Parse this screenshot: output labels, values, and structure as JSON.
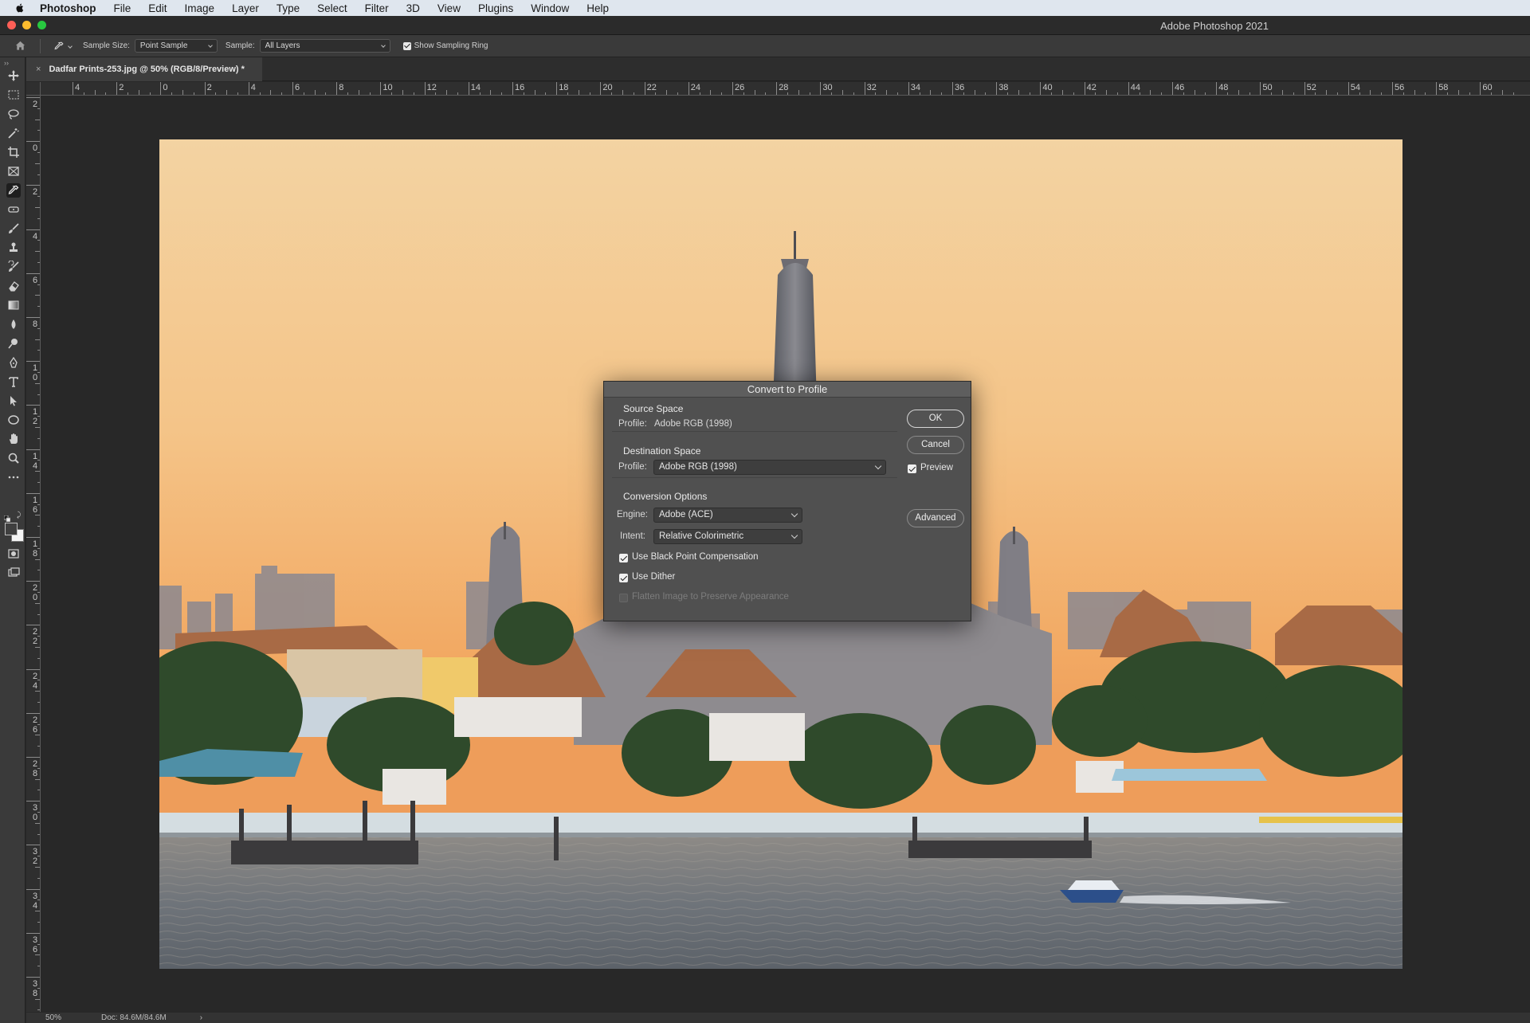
{
  "menubar": {
    "app_name": "Photoshop",
    "items": [
      "File",
      "Edit",
      "Image",
      "Layer",
      "Type",
      "Select",
      "Filter",
      "3D",
      "View",
      "Plugins",
      "Window",
      "Help"
    ]
  },
  "window": {
    "title": "Adobe Photoshop 2021"
  },
  "options_bar": {
    "sample_size_label": "Sample Size:",
    "sample_size_value": "Point Sample",
    "sample_label": "Sample:",
    "sample_value": "All Layers",
    "show_sampling_ring_label": "Show Sampling Ring",
    "show_sampling_ring_checked": true
  },
  "document": {
    "tab_title": "Dadfar Prints-253.jpg @ 50% (RGB/8/Preview) *",
    "close_glyph": "×"
  },
  "rulers": {
    "top_labels": [
      "4",
      "2",
      "0",
      "2",
      "4",
      "6",
      "8",
      "10",
      "12",
      "14",
      "16",
      "18",
      "20",
      "22",
      "24",
      "26",
      "28",
      "30",
      "32",
      "34",
      "36",
      "38",
      "40",
      "42",
      "44",
      "46",
      "48",
      "50",
      "52",
      "54",
      "56",
      "58",
      "60"
    ],
    "left_labels": [
      "2",
      "0",
      "2",
      "4",
      "6",
      "8",
      "10",
      "12",
      "14",
      "16",
      "18",
      "20",
      "22",
      "24",
      "26",
      "28",
      "30",
      "32",
      "34",
      "36",
      "38"
    ]
  },
  "status_bar": {
    "zoom": "50%",
    "doc_size": "Doc: 84.6M/84.6M",
    "arrow": "›"
  },
  "dialog": {
    "title": "Convert to Profile",
    "source_space": {
      "heading": "Source Space",
      "profile_label": "Profile:",
      "profile_value": "Adobe RGB (1998)"
    },
    "destination_space": {
      "heading": "Destination Space",
      "profile_label": "Profile:",
      "profile_value": "Adobe RGB (1998)"
    },
    "conversion_options": {
      "heading": "Conversion Options",
      "engine_label": "Engine:",
      "engine_value": "Adobe (ACE)",
      "intent_label": "Intent:",
      "intent_value": "Relative Colorimetric",
      "black_point_label": "Use Black Point Compensation",
      "black_point_checked": true,
      "dither_label": "Use Dither",
      "dither_checked": true,
      "flatten_label": "Flatten Image to Preserve Appearance",
      "flatten_checked": false
    },
    "buttons": {
      "ok": "OK",
      "cancel": "Cancel",
      "preview_label": "Preview",
      "preview_checked": true,
      "advanced": "Advanced"
    }
  },
  "colors": {
    "traffic_close": "#fe5f57",
    "traffic_minimize": "#febc2e",
    "traffic_zoom": "#28c840",
    "sky_top": "#f3cf96",
    "sky_bottom": "#f1a25a",
    "river": "#6b747c"
  }
}
